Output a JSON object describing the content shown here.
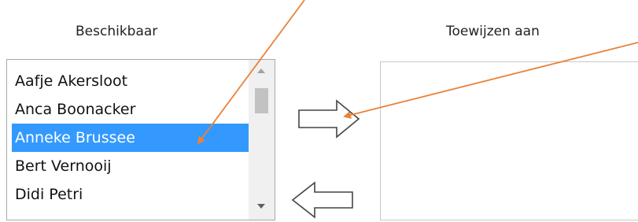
{
  "available": {
    "heading": "Beschikbaar",
    "items": [
      {
        "label": "Aafje Akersloot",
        "selected": false
      },
      {
        "label": "Anca Boonacker",
        "selected": false
      },
      {
        "label": "Anneke Brussee",
        "selected": true
      },
      {
        "label": "Bert Vernooij",
        "selected": false
      },
      {
        "label": "Didi Petri",
        "selected": false
      }
    ]
  },
  "assign": {
    "heading": "Toewijzen aan",
    "items": []
  },
  "buttons": {
    "move_right_icon": "outline-right-arrow-icon",
    "move_left_icon": "outline-left-arrow-icon"
  },
  "colors": {
    "selection": "#3399ff",
    "annotation_arrow": "#e8823a"
  }
}
